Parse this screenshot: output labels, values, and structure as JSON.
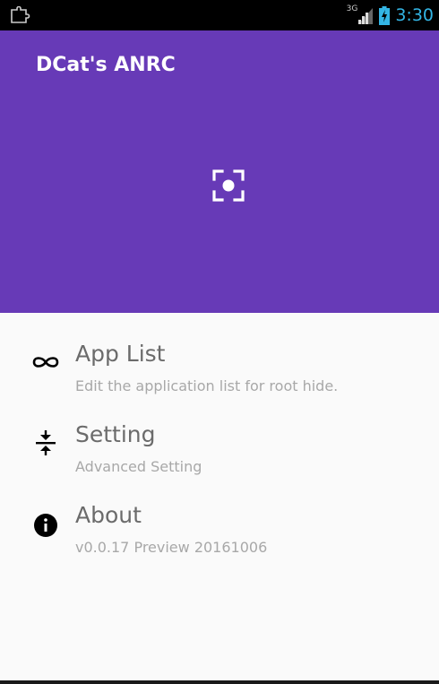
{
  "status_bar": {
    "network_type": "3G",
    "time": "3:30",
    "left_icon": "puzzle-notification-icon",
    "signal_icon": "signal-icon",
    "battery_icon": "battery-charging-icon"
  },
  "header": {
    "title": "DCat's ANRC",
    "icon": "screen-capture-icon",
    "color": "#673ab7"
  },
  "menu": {
    "items": [
      {
        "icon": "infinity-icon",
        "title": "App List",
        "subtitle": "Edit the application list for root hide."
      },
      {
        "icon": "compress-vertical-icon",
        "title": "Setting",
        "subtitle": "Advanced Setting"
      },
      {
        "icon": "info-icon",
        "title": "About",
        "subtitle": "v0.0.17 Preview 20161006"
      }
    ]
  },
  "colors": {
    "status_bar_bg": "#000000",
    "clock": "#33b5e5",
    "title_text": "#6b6b6b",
    "subtitle_text": "#a8a8a8"
  }
}
